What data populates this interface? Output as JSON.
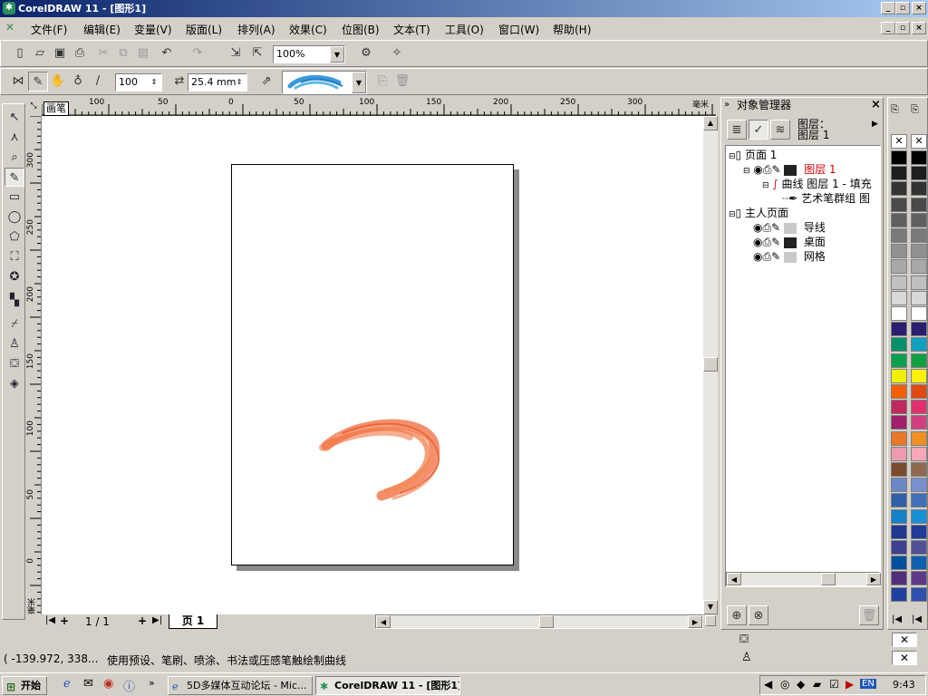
{
  "window": {
    "title": "CorelDRAW 11 - [图形1]",
    "minimize": "_",
    "maximize": "▫",
    "close": "×"
  },
  "menu": [
    "文件(F)",
    "编辑(E)",
    "变量(V)",
    "版面(L)",
    "排列(A)",
    "效果(C)",
    "位图(B)",
    "文本(T)",
    "工具(O)",
    "窗口(W)",
    "帮助(H)"
  ],
  "toolbar": {
    "zoom": "100%"
  },
  "property_bar": {
    "smoothness": "100",
    "width": "25.4 mm"
  },
  "ruler": {
    "corner_label": "画笔",
    "unit": "毫米",
    "h_labels": [
      "100",
      "50",
      "0",
      "50",
      "100",
      "150",
      "200",
      "250",
      "300"
    ],
    "v_labels": [
      "300",
      "250",
      "200",
      "150",
      "100",
      "50",
      "0"
    ]
  },
  "page_nav": {
    "counter": "1 / 1",
    "tab": "页 1"
  },
  "object_manager": {
    "title": "对象管理器",
    "layer_label": "图层：",
    "layer_value": "图层 1",
    "tree": [
      {
        "text": "页面 1",
        "indent": 0
      },
      {
        "text": "图层 1",
        "indent": 1,
        "red": true,
        "color": "#222222"
      },
      {
        "text": "曲线 图层 1 - 填充",
        "indent": 2
      },
      {
        "text": "艺术笔群组 图",
        "indent": 3
      },
      {
        "text": "主人页面",
        "indent": 0
      },
      {
        "text": "导线",
        "indent": 1,
        "color": "#c8c8c8"
      },
      {
        "text": "桌面",
        "indent": 1,
        "color": "#222222"
      },
      {
        "text": "网格",
        "indent": 1,
        "color": "#c8c8c8"
      }
    ]
  },
  "palette": {
    "colors_left": [
      "#000000",
      "#1e1e1e",
      "#333333",
      "#4a4a4a",
      "#606060",
      "#7a7a7a",
      "#909090",
      "#a8a8a8",
      "#c0c0c0",
      "#d8d8d8",
      "#ffffff",
      "#2b1e6e",
      "#00906a",
      "#0aa050",
      "#f0f000",
      "#f06000",
      "#c02860",
      "#a0206a",
      "#e87828",
      "#f09ab0",
      "#7a4a2a",
      "#6a88c8",
      "#3060a8",
      "#1480c8",
      "#1e3a90",
      "#404090",
      "#0050a0",
      "#50307a",
      "#2040a0"
    ],
    "colors_right": [
      "#000000",
      "#1e1e1e",
      "#333333",
      "#4a4a4a",
      "#606060",
      "#7a7a7a",
      "#909090",
      "#a8a8a8",
      "#c0c0c0",
      "#d8d8d8",
      "#ffffff",
      "#2b1e6e",
      "#10a0c0",
      "#10a040",
      "#fff000",
      "#e04a10",
      "#e03070",
      "#d04080",
      "#f09020",
      "#f4a8b8",
      "#906a50",
      "#7890d0",
      "#4070b8",
      "#1890d8",
      "#203c98",
      "#505098",
      "#1060b0",
      "#603888",
      "#3050b0"
    ]
  },
  "status": {
    "coords": "( -139.972, 338...",
    "message": "使用预设、笔刷、喷涂、书法或压感笔触绘制曲线"
  },
  "taskbar": {
    "start": "开始",
    "task1": "5D多媒体互动论坛 - Mic...",
    "task2": "CorelDRAW 11 - [图形1]",
    "lang": "EN",
    "time": "9:43"
  }
}
